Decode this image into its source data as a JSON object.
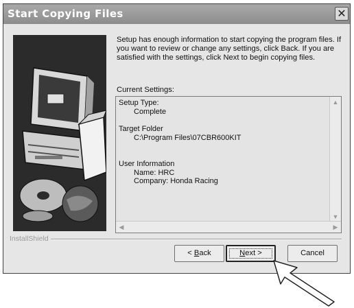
{
  "window": {
    "title": "Start Copying Files",
    "close_symbol": "✕"
  },
  "description": "Setup has enough information to start copying the program files. If you want to review or change any settings, click Back.  If you are satisfied with the settings, click Next to begin copying files.",
  "current_settings": {
    "label": "Current Settings:",
    "lines": {
      "setup_type_label": "Setup Type:",
      "setup_type_value": "Complete",
      "target_folder_label": "Target Folder",
      "target_folder_value": "C:\\Program Files\\07CBR600KIT",
      "user_info_label": "User Information",
      "name_line": "Name:  HRC",
      "company_line": "Company:  Honda Racing"
    }
  },
  "branding": "InstallShield",
  "buttons": {
    "back": {
      "prefix": "< ",
      "mnemonic": "B",
      "rest": "ack"
    },
    "next": {
      "mnemonic": "N",
      "rest": "ext >"
    },
    "cancel": "Cancel"
  },
  "icons": {
    "side_art": "computer-and-cds-illustration",
    "pointer": "arrow-pointer-icon"
  },
  "colors": {
    "titlebar": "#9a9a9a",
    "dialog_bg": "#e6e6e6",
    "side_panel": "#2b2b2b"
  }
}
